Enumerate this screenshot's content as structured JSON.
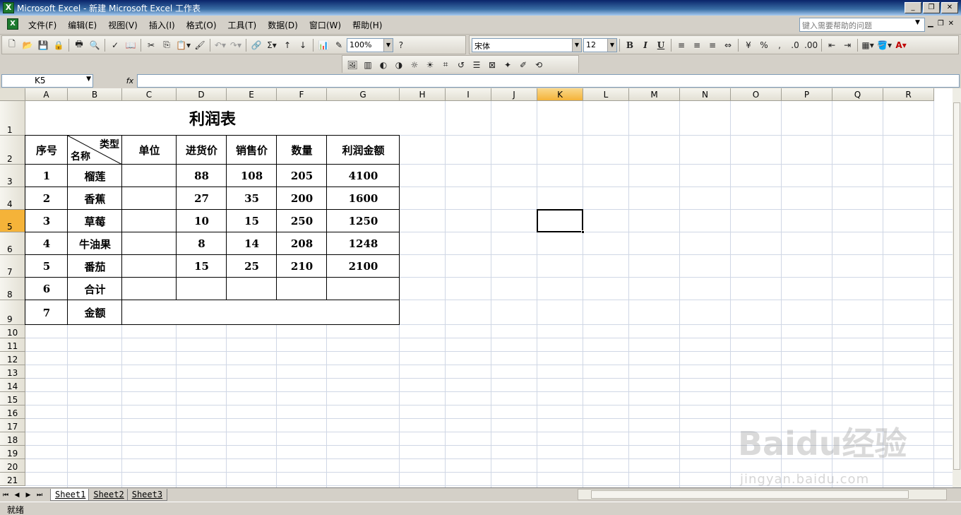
{
  "window": {
    "title": "Microsoft Excel - 新建 Microsoft Excel 工作表",
    "app_icon": "excel-icon",
    "minimize": "_",
    "restore": "❐",
    "close": "✕"
  },
  "menu": [
    "文件(F)",
    "编辑(E)",
    "视图(V)",
    "插入(I)",
    "格式(O)",
    "工具(T)",
    "数据(D)",
    "窗口(W)",
    "帮助(H)"
  ],
  "help": {
    "placeholder": "键入需要帮助的问题"
  },
  "toolbar": {
    "zoom": "100%",
    "font": "宋体",
    "size": "12",
    "bold": "B",
    "italic": "I",
    "underline": "U"
  },
  "formula": {
    "namebox": "K5",
    "fx": "fx",
    "value": ""
  },
  "columns": [
    "A",
    "B",
    "C",
    "D",
    "E",
    "F",
    "G",
    "H",
    "I",
    "J",
    "K",
    "L",
    "M",
    "N",
    "O",
    "P",
    "Q",
    "R"
  ],
  "rows": [
    "1",
    "2",
    "3",
    "4",
    "5",
    "6",
    "7",
    "8",
    "9",
    "10",
    "11",
    "12",
    "13",
    "14",
    "15",
    "16",
    "17",
    "18",
    "19",
    "20",
    "21"
  ],
  "selected_cell": "K5",
  "sheet": {
    "title": "利润表",
    "headers": {
      "seq": "序号",
      "diag_top": "类型",
      "diag_bottom": "名称",
      "unit": "单位",
      "buy": "进货价",
      "sell": "销售价",
      "qty": "数量",
      "profit": "利润金额"
    },
    "data": [
      {
        "seq": "1",
        "name": "榴莲",
        "buy": "88",
        "sell": "108",
        "qty": "205",
        "profit": "4100"
      },
      {
        "seq": "2",
        "name": "香蕉",
        "buy": "27",
        "sell": "35",
        "qty": "200",
        "profit": "1600"
      },
      {
        "seq": "3",
        "name": "草莓",
        "buy": "10",
        "sell": "15",
        "qty": "250",
        "profit": "1250"
      },
      {
        "seq": "4",
        "name": "牛油果",
        "buy": "8",
        "sell": "14",
        "qty": "208",
        "profit": "1248"
      },
      {
        "seq": "5",
        "name": "番茄",
        "buy": "15",
        "sell": "25",
        "qty": "210",
        "profit": "2100"
      }
    ],
    "total": {
      "seq": "6",
      "name": "合计"
    },
    "amount": {
      "seq": "7",
      "name": "金额"
    }
  },
  "tabs": [
    "Sheet1",
    "Sheet2",
    "Sheet3"
  ],
  "status": "就绪",
  "watermark": {
    "logo": "Baidu经验",
    "url": "jingyan.baidu.com"
  }
}
